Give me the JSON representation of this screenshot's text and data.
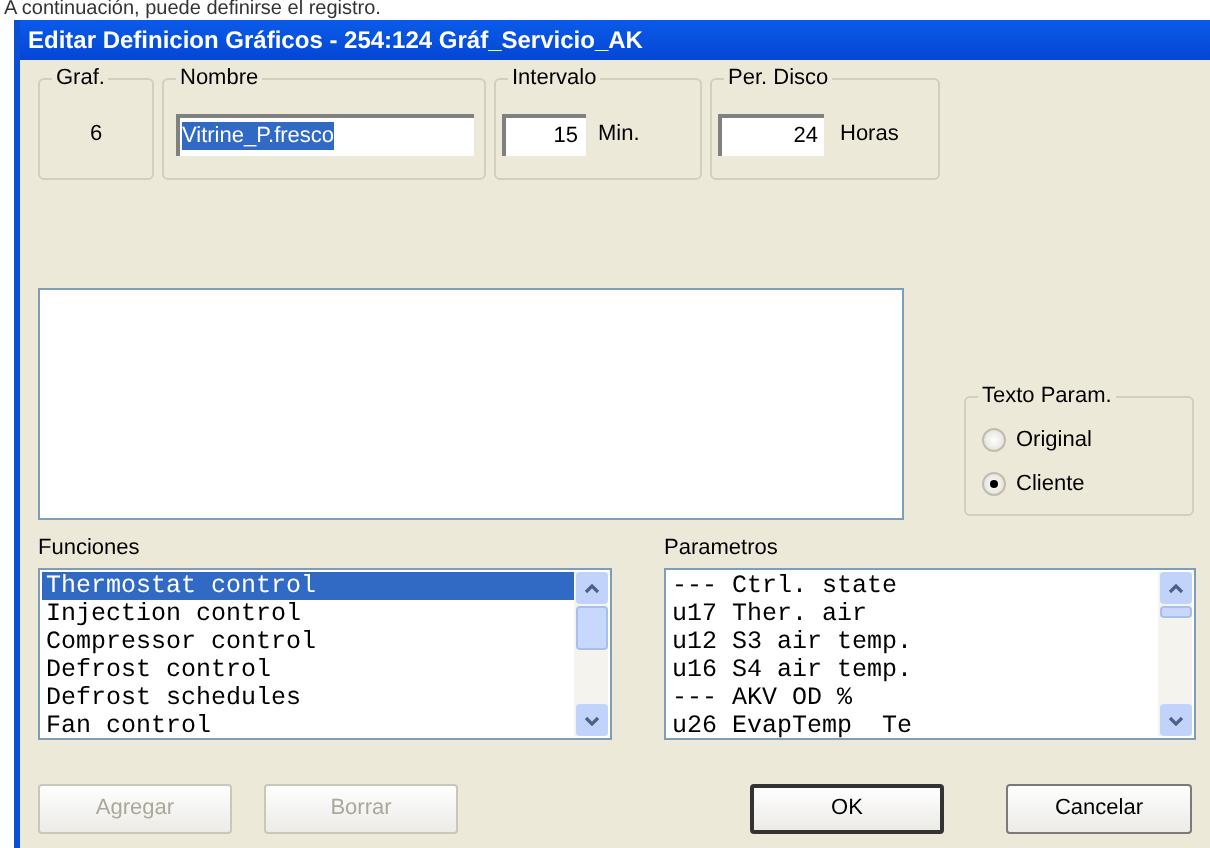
{
  "caption": "A continuación, puede definirse el registro.",
  "window": {
    "title": "Editar Definicion Gráficos - 254:124  Gráf_Servicio_AK"
  },
  "graf": {
    "label": "Graf.",
    "value": "6"
  },
  "nombre": {
    "label": "Nombre",
    "value": "Vitrine_P.fresco"
  },
  "intervalo": {
    "label": "Intervalo",
    "value": "15",
    "unit": "Min."
  },
  "per_disco": {
    "label": "Per. Disco",
    "value": "24",
    "unit": "Horas"
  },
  "texto_param": {
    "label": "Texto Param.",
    "options": [
      {
        "label": "Original",
        "selected": false
      },
      {
        "label": "Cliente",
        "selected": true
      }
    ]
  },
  "funciones": {
    "label": "Funciones",
    "items": [
      {
        "label": "Thermostat control",
        "selected": true
      },
      {
        "label": "Injection control",
        "selected": false
      },
      {
        "label": "Compressor control",
        "selected": false
      },
      {
        "label": "Defrost control",
        "selected": false
      },
      {
        "label": "Defrost schedules",
        "selected": false
      },
      {
        "label": "Fan control",
        "selected": false
      }
    ]
  },
  "parametros": {
    "label": "Parametros",
    "items": [
      "--- Ctrl. state",
      "u17 Ther. air",
      "u12 S3 air temp.",
      "u16 S4 air temp.",
      "--- AKV OD %",
      "u26 EvapTemp  Te"
    ]
  },
  "buttons": [
    {
      "label": "Agregar",
      "disabled": true,
      "default": false
    },
    {
      "label": "Borrar",
      "disabled": true,
      "default": false
    },
    {
      "label": "OK",
      "disabled": false,
      "default": true
    },
    {
      "label": "Cancelar",
      "disabled": false,
      "default": false
    }
  ]
}
